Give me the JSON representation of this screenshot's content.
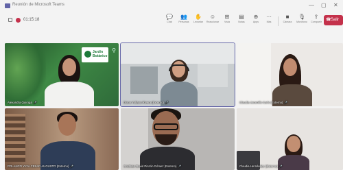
{
  "titlebar": {
    "title": "Reunión de Microsoft Teams",
    "controls": [
      "—",
      "▢",
      "✕"
    ]
  },
  "meeting": {
    "timer": "01:15:18"
  },
  "toolbar": {
    "buttons": [
      {
        "icon": "chat-icon",
        "glyph": "💬",
        "label": "Chat"
      },
      {
        "icon": "people-icon",
        "glyph": "👥",
        "label": "Personas"
      },
      {
        "icon": "raise-hand-icon",
        "glyph": "✋",
        "label": "Levantar"
      },
      {
        "icon": "reactions-icon",
        "glyph": "☺",
        "label": "Reaccionar"
      },
      {
        "icon": "view-icon",
        "glyph": "⊞",
        "label": "Vista"
      },
      {
        "icon": "notes-icon",
        "glyph": "▤",
        "label": "Notas"
      },
      {
        "icon": "apps-icon",
        "glyph": "⊕",
        "label": "Apps"
      },
      {
        "icon": "more-icon",
        "glyph": "···",
        "label": "Más"
      },
      {
        "icon": "camera-icon",
        "glyph": "■",
        "label": "Cámara"
      },
      {
        "icon": "mic-icon",
        "glyph": "🎙",
        "label": "Micrófono"
      },
      {
        "icon": "share-icon",
        "glyph": "⇪",
        "label": "Compartir"
      }
    ],
    "leave_label": "Salir",
    "leave_glyph": "☎"
  },
  "participants": [
    {
      "name": "Alexandra Quiroga",
      "mic": "🎤",
      "bg": "#2f6b3a"
    },
    {
      "name": "Diana Yuliana Rivera (Externo)",
      "mic": "🎤",
      "bg": "#c9cdcf"
    },
    {
      "name": "Claudia Jaramillo Carlo (Externo)",
      "mic": "🎤",
      "bg": "#ece9e6"
    },
    {
      "name": "POLANCO YAYA CESAR AUGUSTO (Externo)",
      "mic": "🎤",
      "bg": "#8b6a55"
    },
    {
      "name": "Cristhian David Pinzón Gómez (Externo)",
      "mic": "🎤",
      "bg": "#b8b6b4"
    },
    {
      "name": "Claudia Hernández (Externo)",
      "mic": "🎤",
      "bg": "#e7e4e1"
    }
  ],
  "brand_logo": {
    "line1": "Jardín",
    "line2": "Botánico"
  },
  "colors": {
    "accent": "#6264a7",
    "leave": "#c4314b"
  }
}
